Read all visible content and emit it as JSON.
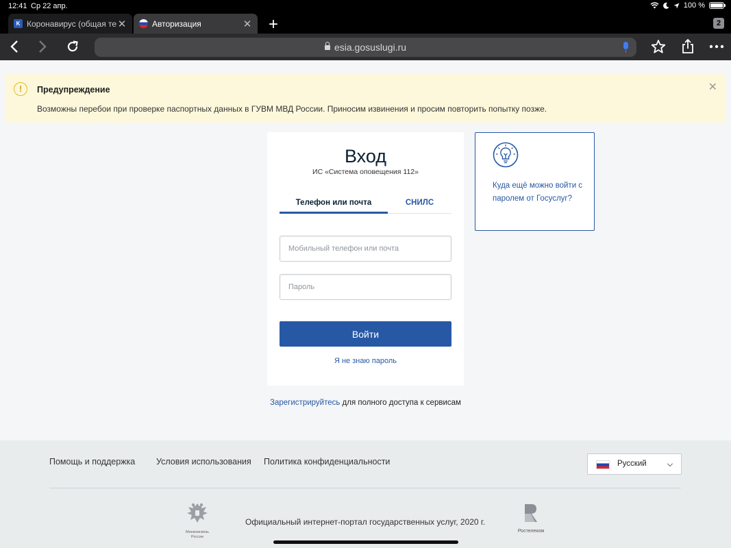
{
  "status_bar": {
    "time": "12:41",
    "date": "Ср 22 апр.",
    "battery": "100 %",
    "battery_level": 1.0
  },
  "browser": {
    "tabs": [
      {
        "favicon_text": "K",
        "title": "Коронавирус (общая тема"
      },
      {
        "title": "Авторизация"
      }
    ],
    "tab_count": "2",
    "url": "esia.gosuslugi.ru"
  },
  "warning": {
    "title": "Предупреждение",
    "text": "Возможны перебои при проверке паспортных данных в ГУВМ МВД России. Приносим извинения и просим повторить попытку позже."
  },
  "login": {
    "title": "Вход",
    "subtitle": "ИС «Система оповещения 112»",
    "tabs": [
      "Телефон или почта",
      "СНИЛС"
    ],
    "login_placeholder": "Мобильный телефон или почта",
    "password_placeholder": "Пароль",
    "submit_label": "Войти",
    "forgot_label": "Я не знаю пароль"
  },
  "side_box": {
    "text": "Куда ещё можно войти с паролем от Госуслуг?"
  },
  "register": {
    "link": "Зарегистрируйтесь",
    "rest": " для полного доступа к сервисам"
  },
  "footer": {
    "links": [
      "Помощь и поддержка",
      "Условия использования",
      "Политика конфиденциальности"
    ],
    "language": "Русский",
    "ministry": "Минкомсвязь России",
    "copyright": "Официальный интернет-портал государственных услуг, 2020 г.",
    "operator": "Ростелеком"
  },
  "colors": {
    "brand_blue": "#2758a5",
    "warning_bg": "#fdf8db",
    "warning_icon": "#e2ba27"
  }
}
